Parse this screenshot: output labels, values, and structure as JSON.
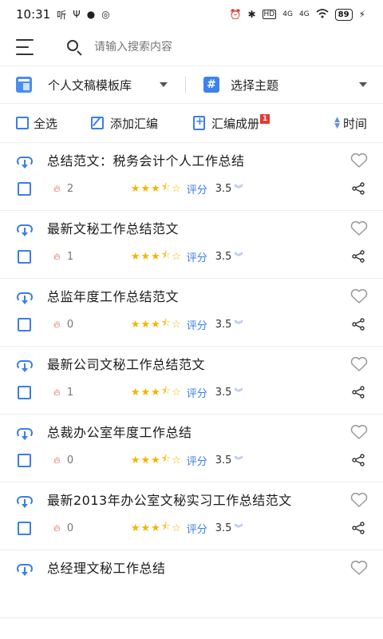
{
  "status": {
    "time": "10:31",
    "left_icons": [
      "听",
      "Ψ",
      "●",
      "◎"
    ],
    "right_icons": [
      "⏰",
      "✱",
      "HD",
      "4G",
      "4G",
      "wifi"
    ],
    "battery": "89"
  },
  "search": {
    "placeholder": "请输入搜索内容"
  },
  "filters": {
    "library_label": "个人文稿模板库",
    "topic_icon": "#",
    "topic_label": "选择主题"
  },
  "actions": {
    "select_all": "全选",
    "add_collection": "添加汇编",
    "compile_book": "汇编成册",
    "compile_badge": "1",
    "sort": "时间"
  },
  "colors": {
    "accent": "#3b7ee8",
    "star": "#f5b300",
    "badge": "#e53935"
  },
  "items": [
    {
      "title": "总结范文：税务会计个人工作总结",
      "views": "2",
      "rate_label": "评分",
      "rating": "3.5",
      "stars": 3.5
    },
    {
      "title": "最新文秘工作总结范文",
      "views": "1",
      "rate_label": "评分",
      "rating": "3.5",
      "stars": 3.5
    },
    {
      "title": "总监年度工作总结范文",
      "views": "0",
      "rate_label": "评分",
      "rating": "3.5",
      "stars": 3.5
    },
    {
      "title": "最新公司文秘工作总结范文",
      "views": "1",
      "rate_label": "评分",
      "rating": "3.5",
      "stars": 3.5
    },
    {
      "title": "总裁办公室年度工作总结",
      "views": "0",
      "rate_label": "评分",
      "rating": "3.5",
      "stars": 3.5
    },
    {
      "title": "最新2013年办公室文秘实习工作总结范文",
      "views": "0",
      "rate_label": "评分",
      "rating": "3.5",
      "stars": 3.5
    },
    {
      "title": "总经理文秘工作总结",
      "views": "",
      "rate_label": "",
      "rating": "",
      "stars": 0
    }
  ]
}
